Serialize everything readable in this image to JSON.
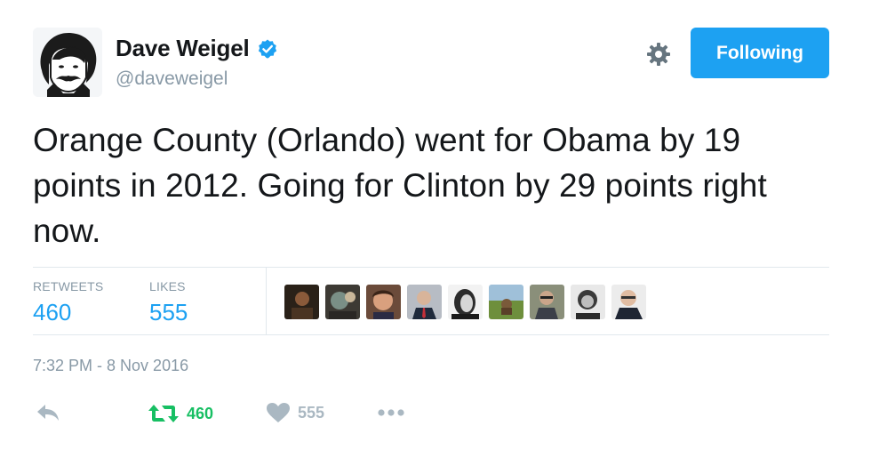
{
  "author": {
    "name": "Dave Weigel",
    "handle": "@daveweigel",
    "verified": true
  },
  "header": {
    "follow_button_label": "Following",
    "settings_icon": "gear-icon"
  },
  "tweet": {
    "text": "Orange County (Orlando) went for Obama by 19 points in 2012. Going for Clinton by 29 points right now.",
    "timestamp": "7:32 PM - 8 Nov 2016"
  },
  "stats": {
    "retweets_label": "RETWEETS",
    "retweets_count": "460",
    "likes_label": "LIKES",
    "likes_count": "555"
  },
  "actions": {
    "reply_icon": "reply-icon",
    "retweet_icon": "retweet-icon",
    "retweet_count": "460",
    "like_icon": "heart-icon",
    "like_count": "555",
    "more_icon": "more-icon"
  },
  "colors": {
    "accent": "#1da1f2",
    "retweet_green": "#17bf63",
    "muted": "#8899a6",
    "text": "#14171a"
  },
  "liker_avatar_count": 9
}
